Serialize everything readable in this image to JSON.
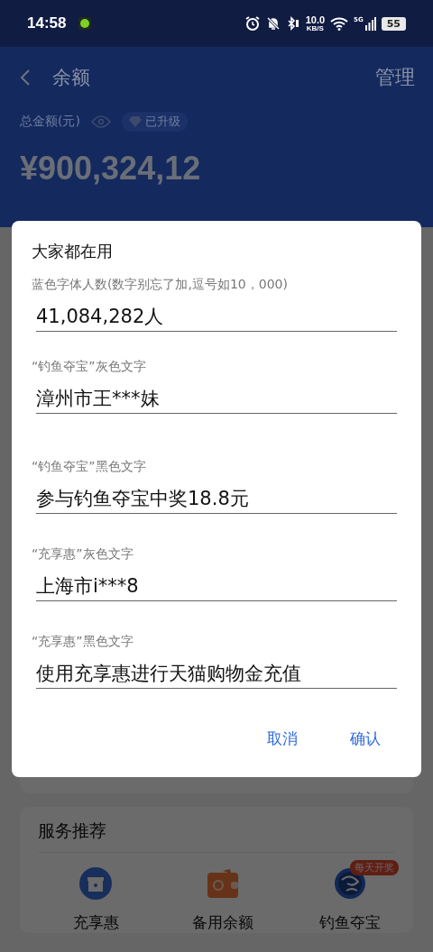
{
  "status_bar": {
    "time": "14:58",
    "net_speed": "10.0",
    "net_unit": "KB/S",
    "network": "5G",
    "battery": "55"
  },
  "header": {
    "title": "余额",
    "action": "管理"
  },
  "balance": {
    "label": "总金额(元)",
    "badge": "已升级",
    "amount": "¥900,324,12"
  },
  "services": {
    "title": "服务推荐",
    "items": [
      {
        "kind": "gift",
        "name": "充享惠"
      },
      {
        "kind": "wallet",
        "name": "备用余额"
      },
      {
        "kind": "fish",
        "name": "钓鱼夺宝",
        "badge": "每天开奖"
      }
    ]
  },
  "dialog": {
    "title": "大家都在用",
    "fields": [
      {
        "label": "蓝色字体人数(数字别忘了加,逗号如10，000)",
        "value": "41,084,282人"
      },
      {
        "label": "“钓鱼夺宝”灰色文字",
        "value": "漳州市王***妹"
      },
      {
        "label": "“钓鱼夺宝”黑色文字",
        "value": "参与钓鱼夺宝中奖18.8元"
      },
      {
        "label": "“充享惠”灰色文字",
        "value": "上海市i***8"
      },
      {
        "label": "“充享惠”黑色文字",
        "value": "使用充享惠进行天猫购物金充值"
      }
    ],
    "buttons": [
      "取消",
      "确认"
    ]
  }
}
